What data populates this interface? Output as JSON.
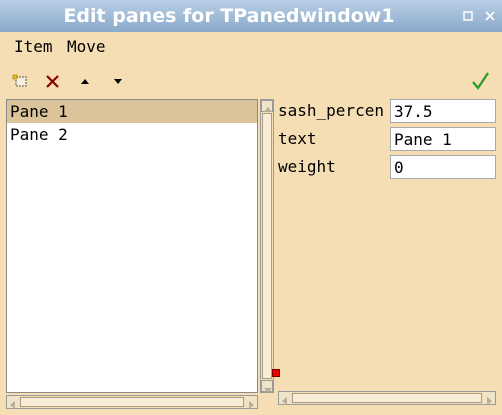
{
  "window": {
    "title": "Edit panes for TPanedwindow1"
  },
  "menu": {
    "items": [
      "Item",
      "Move"
    ]
  },
  "toolbar": {
    "icons": [
      "add-item-icon",
      "delete-icon",
      "move-up-icon",
      "move-down-icon",
      "confirm-check-icon"
    ],
    "accent": {
      "delete": "#8b0000",
      "confirm": "#2a9a2a"
    }
  },
  "panes": {
    "items": [
      "Pane 1",
      "Pane 2"
    ],
    "selected": "Pane 1"
  },
  "properties": [
    {
      "name": "sash_percent",
      "shown": "sash_percen",
      "value": "37.5"
    },
    {
      "name": "text",
      "shown": "text",
      "value": "Pane 1"
    },
    {
      "name": "weight",
      "shown": "weight",
      "value": "0"
    }
  ],
  "colors": {
    "background": "#f5deb3",
    "selection": "#dcc49a",
    "titlebar": "#8aa9c9",
    "sash_marker": "#ee0000"
  }
}
